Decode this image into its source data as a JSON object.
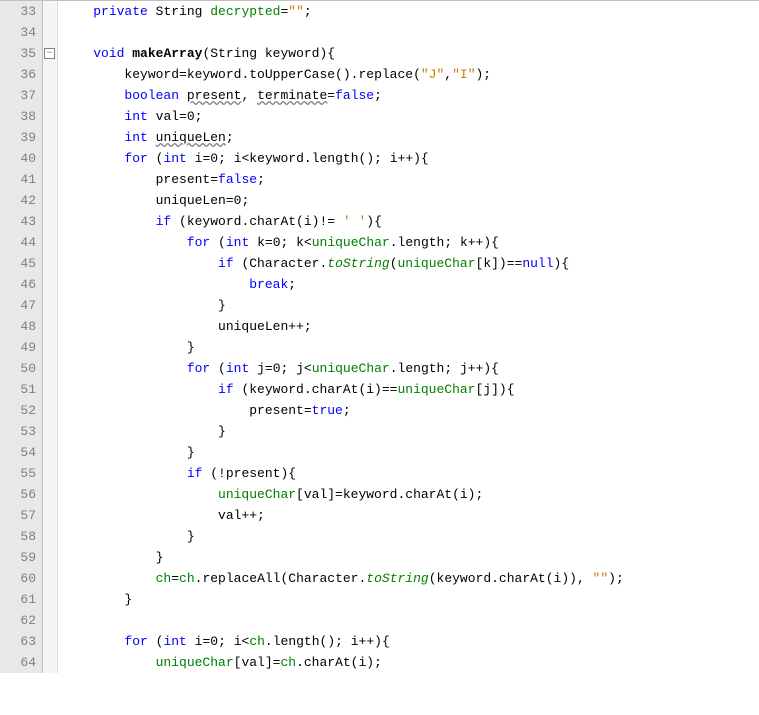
{
  "lines": [
    {
      "num": "33",
      "indent": "    ",
      "tokens": [
        {
          "t": "private ",
          "c": "kw"
        },
        {
          "t": "String ",
          "c": ""
        },
        {
          "t": "decrypted",
          "c": "field"
        },
        {
          "t": "=",
          "c": ""
        },
        {
          "t": "\"\"",
          "c": "str"
        },
        {
          "t": ";",
          "c": ""
        }
      ]
    },
    {
      "num": "34",
      "indent": "",
      "tokens": []
    },
    {
      "num": "35",
      "indent": "    ",
      "fold": true,
      "tokens": [
        {
          "t": "void ",
          "c": "kw"
        },
        {
          "t": "makeArray",
          "c": "bold"
        },
        {
          "t": "(String keyword){",
          "c": ""
        }
      ]
    },
    {
      "num": "36",
      "indent": "        ",
      "tokens": [
        {
          "t": "keyword=keyword.toUpperCase().replace(",
          "c": ""
        },
        {
          "t": "\"J\"",
          "c": "str"
        },
        {
          "t": ",",
          "c": ""
        },
        {
          "t": "\"I\"",
          "c": "str"
        },
        {
          "t": ");",
          "c": ""
        }
      ]
    },
    {
      "num": "37",
      "indent": "        ",
      "tokens": [
        {
          "t": "boolean ",
          "c": "kw"
        },
        {
          "t": "present",
          "c": "underline"
        },
        {
          "t": ", ",
          "c": ""
        },
        {
          "t": "terminate",
          "c": "underline"
        },
        {
          "t": "=",
          "c": ""
        },
        {
          "t": "false",
          "c": "kw"
        },
        {
          "t": ";",
          "c": ""
        }
      ]
    },
    {
      "num": "38",
      "indent": "        ",
      "tokens": [
        {
          "t": "int ",
          "c": "kw"
        },
        {
          "t": "val=",
          "c": ""
        },
        {
          "t": "0",
          "c": ""
        },
        {
          "t": ";",
          "c": ""
        }
      ]
    },
    {
      "num": "39",
      "indent": "        ",
      "tokens": [
        {
          "t": "int ",
          "c": "kw"
        },
        {
          "t": "uniqueLen",
          "c": "underline"
        },
        {
          "t": ";",
          "c": ""
        }
      ]
    },
    {
      "num": "40",
      "indent": "        ",
      "tokens": [
        {
          "t": "for ",
          "c": "kw"
        },
        {
          "t": "(",
          "c": ""
        },
        {
          "t": "int ",
          "c": "kw"
        },
        {
          "t": "i=",
          "c": ""
        },
        {
          "t": "0",
          "c": ""
        },
        {
          "t": "; i<keyword.length(); i++){",
          "c": ""
        }
      ]
    },
    {
      "num": "41",
      "indent": "            ",
      "tokens": [
        {
          "t": "present=",
          "c": ""
        },
        {
          "t": "false",
          "c": "kw"
        },
        {
          "t": ";",
          "c": ""
        }
      ]
    },
    {
      "num": "42",
      "indent": "            ",
      "tokens": [
        {
          "t": "uniqueLen=",
          "c": ""
        },
        {
          "t": "0",
          "c": ""
        },
        {
          "t": ";",
          "c": ""
        }
      ]
    },
    {
      "num": "43",
      "indent": "            ",
      "tokens": [
        {
          "t": "if ",
          "c": "kw"
        },
        {
          "t": "(keyword.charAt(i)!= ",
          "c": ""
        },
        {
          "t": "' '",
          "c": "str"
        },
        {
          "t": "){",
          "c": ""
        }
      ]
    },
    {
      "num": "44",
      "indent": "                ",
      "tokens": [
        {
          "t": "for ",
          "c": "kw"
        },
        {
          "t": "(",
          "c": ""
        },
        {
          "t": "int ",
          "c": "kw"
        },
        {
          "t": "k=",
          "c": ""
        },
        {
          "t": "0",
          "c": ""
        },
        {
          "t": "; k<",
          "c": ""
        },
        {
          "t": "uniqueChar",
          "c": "field"
        },
        {
          "t": ".length; k++){",
          "c": ""
        }
      ]
    },
    {
      "num": "45",
      "indent": "                    ",
      "tokens": [
        {
          "t": "if ",
          "c": "kw"
        },
        {
          "t": "(Character.",
          "c": ""
        },
        {
          "t": "toString",
          "c": "static"
        },
        {
          "t": "(",
          "c": ""
        },
        {
          "t": "uniqueChar",
          "c": "field"
        },
        {
          "t": "[k])==",
          "c": ""
        },
        {
          "t": "null",
          "c": "kw"
        },
        {
          "t": "){",
          "c": ""
        }
      ]
    },
    {
      "num": "46",
      "indent": "                        ",
      "tokens": [
        {
          "t": "break",
          "c": "kw"
        },
        {
          "t": ";",
          "c": ""
        }
      ]
    },
    {
      "num": "47",
      "indent": "                    ",
      "tokens": [
        {
          "t": "}",
          "c": ""
        }
      ]
    },
    {
      "num": "48",
      "indent": "                    ",
      "tokens": [
        {
          "t": "uniqueLen++;",
          "c": ""
        }
      ]
    },
    {
      "num": "49",
      "indent": "                ",
      "tokens": [
        {
          "t": "}",
          "c": ""
        }
      ]
    },
    {
      "num": "50",
      "indent": "                ",
      "tokens": [
        {
          "t": "for ",
          "c": "kw"
        },
        {
          "t": "(",
          "c": ""
        },
        {
          "t": "int ",
          "c": "kw"
        },
        {
          "t": "j=",
          "c": ""
        },
        {
          "t": "0",
          "c": ""
        },
        {
          "t": "; j<",
          "c": ""
        },
        {
          "t": "uniqueChar",
          "c": "field"
        },
        {
          "t": ".length; j++){",
          "c": ""
        }
      ]
    },
    {
      "num": "51",
      "indent": "                    ",
      "tokens": [
        {
          "t": "if ",
          "c": "kw"
        },
        {
          "t": "(keyword.charAt(i)==",
          "c": ""
        },
        {
          "t": "uniqueChar",
          "c": "field"
        },
        {
          "t": "[j]){",
          "c": ""
        }
      ]
    },
    {
      "num": "52",
      "indent": "                        ",
      "tokens": [
        {
          "t": "present=",
          "c": ""
        },
        {
          "t": "true",
          "c": "kw"
        },
        {
          "t": ";",
          "c": ""
        }
      ]
    },
    {
      "num": "53",
      "indent": "                    ",
      "tokens": [
        {
          "t": "}",
          "c": ""
        }
      ]
    },
    {
      "num": "54",
      "indent": "                ",
      "tokens": [
        {
          "t": "}",
          "c": ""
        }
      ]
    },
    {
      "num": "55",
      "indent": "                ",
      "tokens": [
        {
          "t": "if ",
          "c": "kw"
        },
        {
          "t": "(!present){",
          "c": ""
        }
      ]
    },
    {
      "num": "56",
      "indent": "                    ",
      "tokens": [
        {
          "t": "uniqueChar",
          "c": "field"
        },
        {
          "t": "[val]=keyword.charAt(i);",
          "c": ""
        }
      ]
    },
    {
      "num": "57",
      "indent": "                    ",
      "tokens": [
        {
          "t": "val++;",
          "c": ""
        }
      ]
    },
    {
      "num": "58",
      "indent": "                ",
      "tokens": [
        {
          "t": "}",
          "c": ""
        }
      ]
    },
    {
      "num": "59",
      "indent": "            ",
      "tokens": [
        {
          "t": "}",
          "c": ""
        }
      ]
    },
    {
      "num": "60",
      "indent": "            ",
      "tokens": [
        {
          "t": "ch",
          "c": "field"
        },
        {
          "t": "=",
          "c": ""
        },
        {
          "t": "ch",
          "c": "field"
        },
        {
          "t": ".replaceAll(Character.",
          "c": ""
        },
        {
          "t": "toString",
          "c": "static"
        },
        {
          "t": "(keyword.charAt(i)), ",
          "c": ""
        },
        {
          "t": "\"\"",
          "c": "str"
        },
        {
          "t": ");",
          "c": ""
        }
      ]
    },
    {
      "num": "61",
      "indent": "        ",
      "tokens": [
        {
          "t": "}",
          "c": ""
        }
      ]
    },
    {
      "num": "62",
      "indent": "",
      "tokens": []
    },
    {
      "num": "63",
      "indent": "        ",
      "tokens": [
        {
          "t": "for ",
          "c": "kw"
        },
        {
          "t": "(",
          "c": ""
        },
        {
          "t": "int ",
          "c": "kw"
        },
        {
          "t": "i=",
          "c": ""
        },
        {
          "t": "0",
          "c": ""
        },
        {
          "t": "; i<",
          "c": ""
        },
        {
          "t": "ch",
          "c": "field"
        },
        {
          "t": ".length(); i++){",
          "c": ""
        }
      ]
    },
    {
      "num": "64",
      "indent": "            ",
      "tokens": [
        {
          "t": "uniqueChar",
          "c": "field"
        },
        {
          "t": "[val]=",
          "c": ""
        },
        {
          "t": "ch",
          "c": "field"
        },
        {
          "t": ".charAt(i);",
          "c": ""
        }
      ]
    }
  ]
}
